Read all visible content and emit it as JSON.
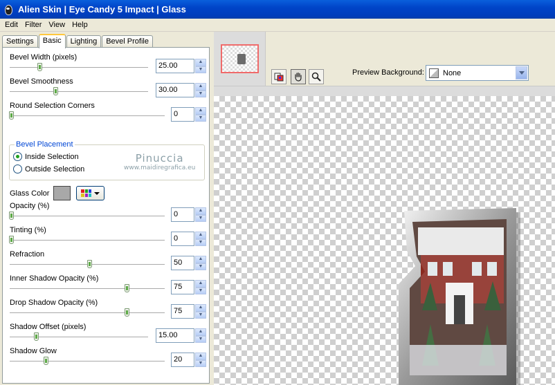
{
  "window": {
    "title": "Alien Skin  |  Eye Candy 5 Impact  |  Glass",
    "title_bar_color": "#0044c8"
  },
  "menu": {
    "items": [
      "Edit",
      "Filter",
      "View",
      "Help"
    ]
  },
  "tabs": [
    {
      "label": "Settings",
      "active": false
    },
    {
      "label": "Basic",
      "active": true
    },
    {
      "label": "Lighting",
      "active": false
    },
    {
      "label": "Bevel Profile",
      "active": false
    }
  ],
  "params": {
    "bevel_width": {
      "label": "Bevel Width (pixels)",
      "value": "25.00"
    },
    "bevel_smoothness": {
      "label": "Bevel Smoothness",
      "value": "30.00"
    },
    "round_corners": {
      "label": "Round Selection Corners",
      "value": "0"
    },
    "opacity": {
      "label": "Opacity (%)",
      "value": "0"
    },
    "tinting": {
      "label": "Tinting (%)",
      "value": "0"
    },
    "refraction": {
      "label": "Refraction",
      "value": "50"
    },
    "inner_shadow": {
      "label": "Inner Shadow Opacity (%)",
      "value": "75"
    },
    "drop_shadow": {
      "label": "Drop Shadow Opacity (%)",
      "value": "75"
    },
    "shadow_offset": {
      "label": "Shadow Offset (pixels)",
      "value": "15.00"
    },
    "shadow_glow": {
      "label": "Shadow Glow",
      "value": "20"
    }
  },
  "bevel_placement": {
    "label": "Bevel Placement",
    "inside": "Inside Selection",
    "outside": "Outside Selection",
    "selected": "inside"
  },
  "watermark": {
    "line1": "Pinuccia",
    "line2": "www.maidiregrafica.eu"
  },
  "glass_color": {
    "label": "Glass Color",
    "value": "#a8a8a8"
  },
  "preview_controls": {
    "background_label": "Preview Background:",
    "background_value": "None",
    "tools": [
      "color-picker-icon",
      "hand-icon",
      "zoom-icon"
    ]
  },
  "accent_colors": {
    "slider_thumb": "#5caa46",
    "group_label": "#0046d5",
    "nav_frame": "#f06a6a"
  }
}
